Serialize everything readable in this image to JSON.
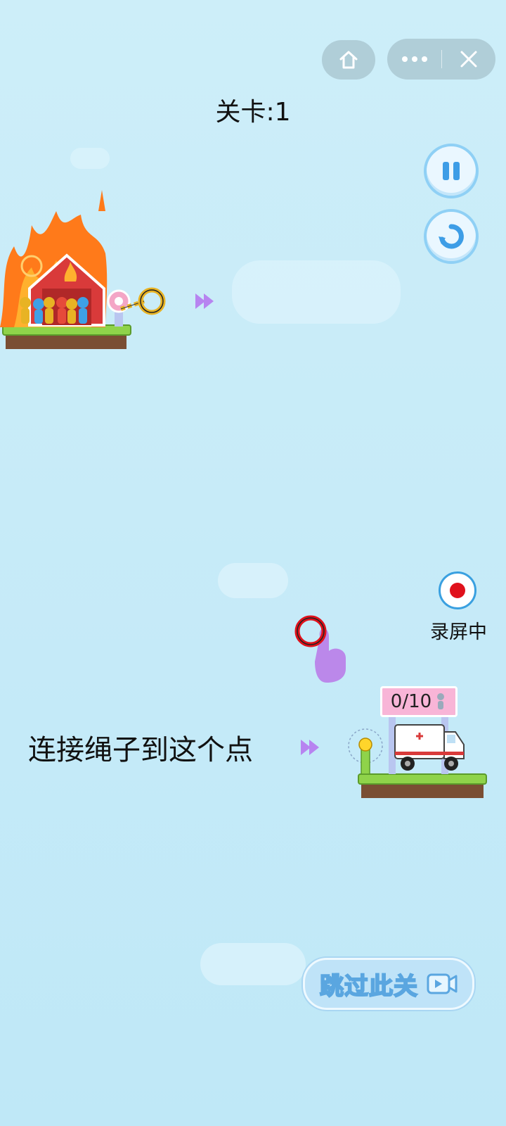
{
  "level": {
    "text": "关卡:1"
  },
  "instruction": {
    "text": "连接绳子到这个点"
  },
  "record": {
    "label": "录屏中"
  },
  "counter": {
    "text": "0/10"
  },
  "skip": {
    "label": "跳过此关"
  },
  "capsule": {
    "home_icon": "home-icon",
    "more_icon": "more-icon",
    "close_icon": "close-icon"
  },
  "controls": {
    "pause_icon": "pause-icon",
    "restart_icon": "restart-icon"
  },
  "colors": {
    "accent": "#8fd0f5",
    "record_red": "#e0111b",
    "counter_pink": "#f8b5d7",
    "arrow_purple": "#b784f0"
  }
}
